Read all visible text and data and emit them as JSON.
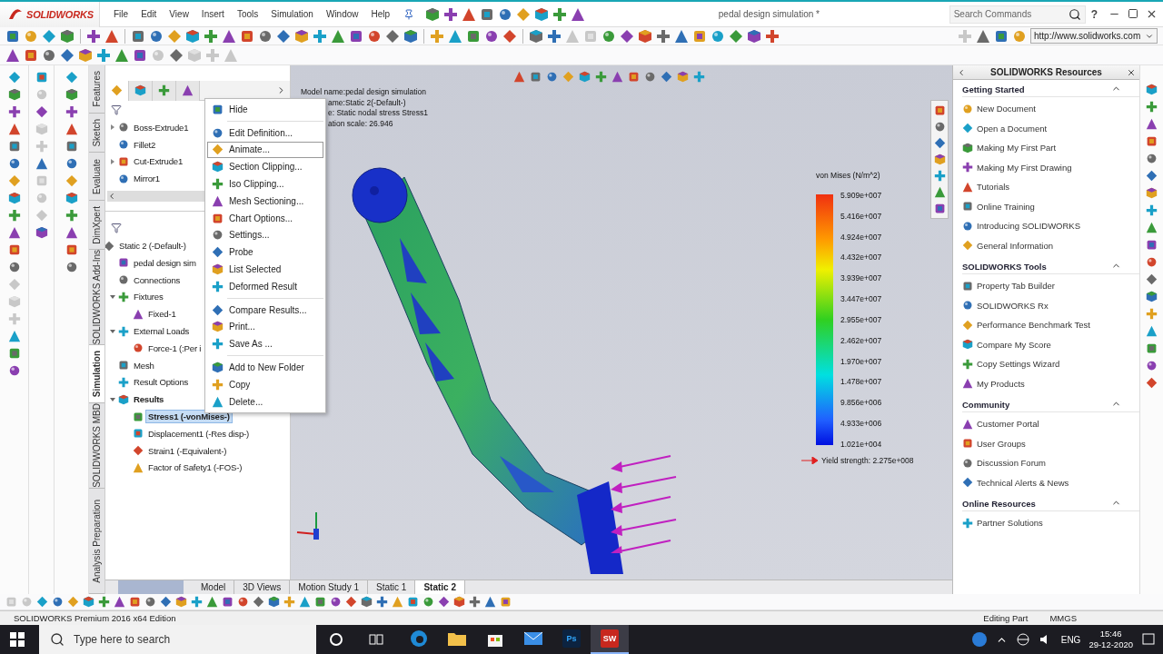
{
  "app": {
    "logo": "SOLIDWORKS",
    "menus": [
      "File",
      "Edit",
      "View",
      "Insert",
      "Tools",
      "Simulation",
      "Window",
      "Help"
    ],
    "document_title": "pedal design simulation *",
    "search": {
      "placeholder": "Search Commands"
    },
    "help": "?"
  },
  "address_bar": {
    "value": "http://www.solidworks.com"
  },
  "vertical_tabs": [
    {
      "label": "Features",
      "selected": false
    },
    {
      "label": "Sketch",
      "selected": false
    },
    {
      "label": "Evaluate",
      "selected": false
    },
    {
      "label": "DimXpert",
      "selected": false
    },
    {
      "label": "SOLIDWORKS Add-Ins",
      "selected": false
    },
    {
      "label": "Simulation",
      "selected": true
    },
    {
      "label": "SOLIDWORKS MBD",
      "selected": false
    },
    {
      "label": "Analysis Preparation",
      "selected": false
    }
  ],
  "feature_tree": [
    {
      "label": "Boss-Extrude1",
      "expanded": false
    },
    {
      "label": "Fillet2"
    },
    {
      "label": "Cut-Extrude1",
      "expanded": false
    },
    {
      "label": "Mirror1"
    }
  ],
  "simulation_tree": [
    {
      "label": "Static 2 (-Default-)",
      "selected": false,
      "active": false,
      "children": [
        {
          "label": "pedal design sim",
          "selected": false,
          "active": false
        },
        {
          "label": "Connections",
          "selected": false,
          "active": false
        },
        {
          "label": "Fixtures",
          "selected": false,
          "active": false,
          "expanded": true,
          "children": [
            {
              "label": "Fixed-1",
              "selected": false,
              "active": false
            }
          ]
        },
        {
          "label": "External Loads",
          "selected": false,
          "active": false,
          "expanded": true,
          "children": [
            {
              "label": "Force-1 (:Per i",
              "selected": false,
              "active": false
            }
          ]
        },
        {
          "label": "Mesh",
          "selected": false,
          "active": false
        },
        {
          "label": "Result Options",
          "selected": false,
          "active": false
        },
        {
          "label": "Results",
          "selected": false,
          "active": true,
          "expanded": true,
          "children": [
            {
              "label": "Stress1 (-vonMises-)",
              "selected": true,
              "active": true
            },
            {
              "label": "Displacement1 (-Res disp-)",
              "selected": false,
              "active": false
            },
            {
              "label": "Strain1 (-Equivalent-)",
              "selected": false,
              "active": false
            },
            {
              "label": "Factor of Safety1 (-FOS-)",
              "selected": false,
              "active": false
            }
          ]
        }
      ]
    }
  ],
  "context_menu": [
    [
      {
        "label": "Hide",
        "selected": false
      }
    ],
    [
      {
        "label": "Edit Definition...",
        "selected": false
      },
      {
        "label": "Animate...",
        "selected": true
      },
      {
        "label": "Section Clipping...",
        "selected": false
      },
      {
        "label": "Iso Clipping...",
        "selected": false
      },
      {
        "label": "Mesh Sectioning...",
        "selected": false
      },
      {
        "label": "Chart Options...",
        "selected": false
      },
      {
        "label": "Settings...",
        "selected": false
      },
      {
        "label": "Probe",
        "selected": false
      },
      {
        "label": "List Selected",
        "selected": false
      },
      {
        "label": "Deformed Result",
        "selected": false
      }
    ],
    [
      {
        "label": "Compare Results...",
        "selected": false
      },
      {
        "label": "Print...",
        "selected": false
      },
      {
        "label": "Save As ...",
        "selected": false
      }
    ],
    [
      {
        "label": "Add to New Folder",
        "selected": false
      },
      {
        "label": "Copy",
        "selected": false
      },
      {
        "label": "Delete...",
        "selected": false
      }
    ]
  ],
  "viewport": {
    "info_lines": [
      "Model name:pedal design simulation",
      "ame:Static 2(-Default-)",
      "e: Static nodal stress Stress1",
      "ation scale: 26.946"
    ],
    "legend": {
      "title": "von Mises (N/m^2)",
      "values": [
        "5.909e+007",
        "5.416e+007",
        "4.924e+007",
        "4.432e+007",
        "3.939e+007",
        "3.447e+007",
        "2.955e+007",
        "2.462e+007",
        "1.970e+007",
        "1.478e+007",
        "9.856e+006",
        "4.933e+006",
        "1.021e+004"
      ],
      "yield": "Yield strength: 2.275e+008"
    }
  },
  "bottom_tabs": [
    {
      "label": "Model",
      "selected": false
    },
    {
      "label": "3D Views",
      "selected": false
    },
    {
      "label": "Motion Study 1",
      "selected": false
    },
    {
      "label": "Static 1",
      "selected": false
    },
    {
      "label": "Static 2",
      "selected": true
    }
  ],
  "resources": {
    "title": "SOLIDWORKS Resources",
    "sections": [
      {
        "title": "Getting Started",
        "expanded": true,
        "items": [
          "New Document",
          "Open a Document",
          "Making My First Part",
          "Making My First Drawing",
          "Tutorials",
          "Online Training",
          "Introducing SOLIDWORKS",
          "General Information"
        ]
      },
      {
        "title": "SOLIDWORKS Tools",
        "expanded": true,
        "items": [
          "Property Tab Builder",
          "SOLIDWORKS Rx",
          "Performance Benchmark Test",
          "Compare My Score",
          "Copy Settings Wizard",
          "My Products"
        ]
      },
      {
        "title": "Community",
        "expanded": true,
        "items": [
          "Customer Portal",
          "User Groups",
          "Discussion Forum",
          "Technical Alerts & News"
        ]
      },
      {
        "title": "Online Resources",
        "expanded": true,
        "items": [
          "Partner Solutions"
        ]
      }
    ]
  },
  "status_bar": {
    "edition": "SOLIDWORKS Premium 2016 x64 Edition",
    "mode": "Editing Part",
    "units": "MMGS"
  },
  "taskbar": {
    "search_placeholder": "Type here to search",
    "apps": [
      {
        "kind": "edge",
        "selected": false
      },
      {
        "kind": "folder",
        "selected": false
      },
      {
        "kind": "store",
        "selected": false
      },
      {
        "kind": "mail",
        "selected": false
      },
      {
        "kind": "photoshop",
        "label": "Ps",
        "selected": false
      },
      {
        "kind": "solidworks",
        "label": "SW",
        "selected": true
      }
    ],
    "language": "ENG",
    "time": "15:46",
    "date": "29-12-2020"
  }
}
